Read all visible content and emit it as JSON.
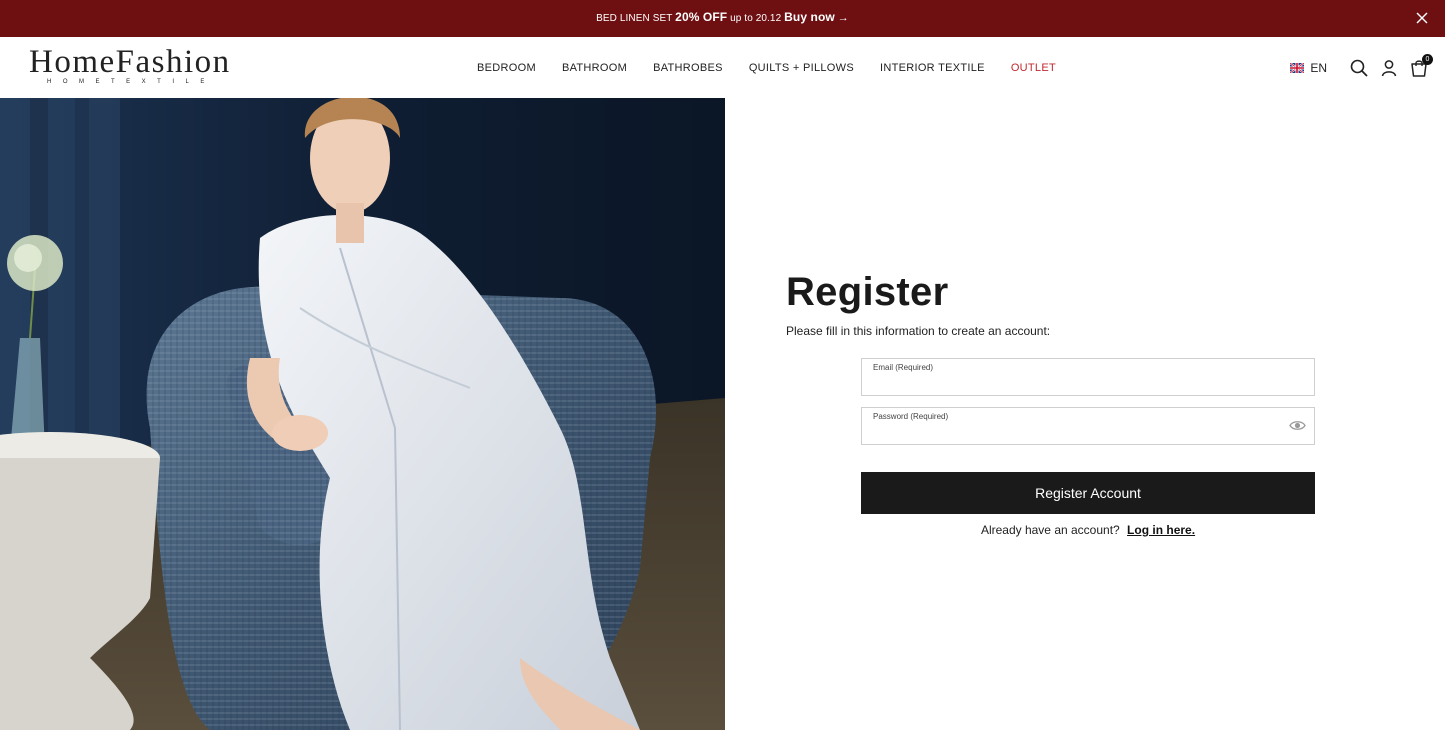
{
  "promo": {
    "part1": "BED LINEN SET",
    "discount": "20% OFF",
    "part2": "up to 20.12",
    "cta": "Buy now",
    "arrow": "→"
  },
  "brand": {
    "name": "HomeFashion",
    "subtitle": "HOMETEXTILE"
  },
  "nav": {
    "items": [
      "BEDROOM",
      "BATHROOM",
      "BATHROBES",
      "QUILTS + PILLOWS",
      "INTERIOR TEXTILE",
      "OUTLET"
    ]
  },
  "header": {
    "language": "EN",
    "cart_count": "0"
  },
  "form": {
    "title": "Register",
    "subtitle": "Please fill in this information to create an account:",
    "email_label": "Email (Required)",
    "email_value": "",
    "password_label": "Password (Required)",
    "password_value": "",
    "submit_label": "Register Account",
    "login_prompt": "Already have an account?",
    "login_link": "Log in here."
  },
  "colors": {
    "promo_bg": "#6e0f12",
    "outlet": "#c0282d",
    "button_bg": "#1a1a1a"
  }
}
